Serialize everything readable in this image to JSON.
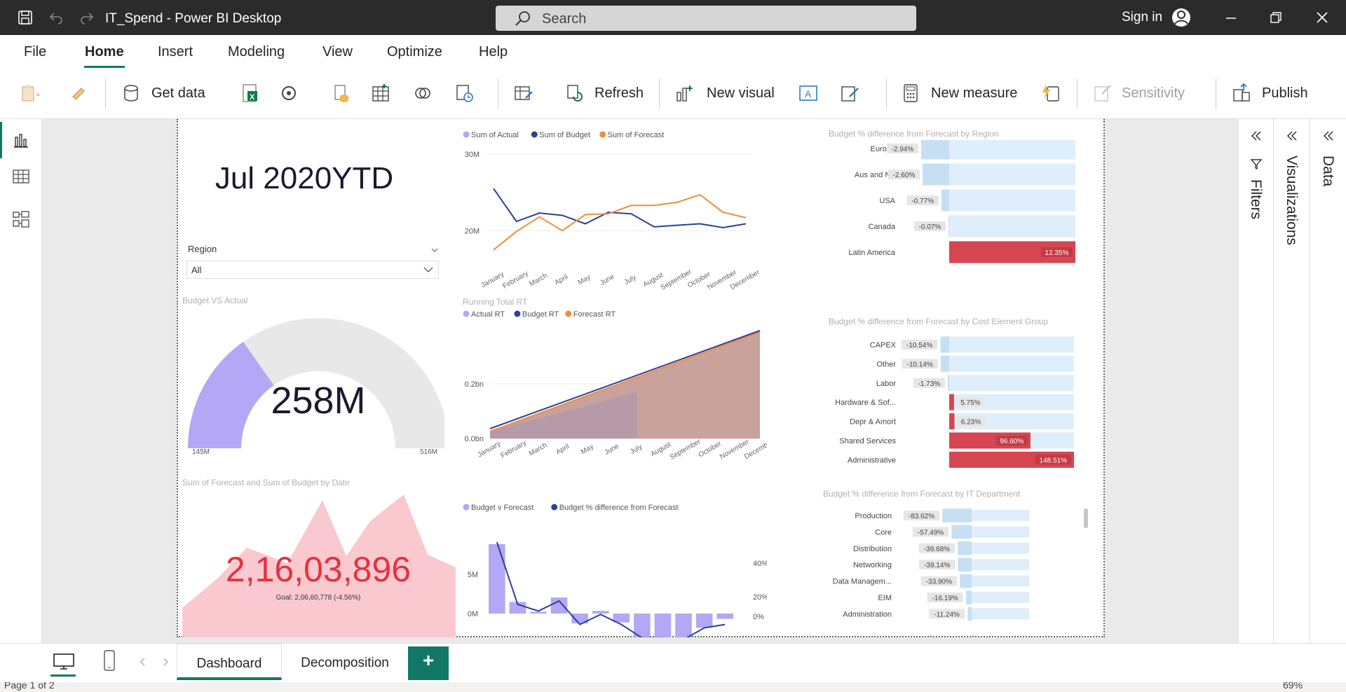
{
  "app": {
    "title": "IT_Spend - Power BI Desktop",
    "search_placeholder": "Search",
    "sign_in": "Sign in"
  },
  "menu": [
    "File",
    "Home",
    "Insert",
    "Modeling",
    "View",
    "Optimize",
    "Help"
  ],
  "ribbon": {
    "get_data": "Get data",
    "refresh": "Refresh",
    "new_visual": "New visual",
    "new_measure": "New measure",
    "sensitivity": "Sensitivity",
    "publish": "Publish"
  },
  "panes": {
    "filters": "Filters",
    "visualizations": "Visualizations",
    "data": "Data"
  },
  "pages": {
    "dashboard": "Dashboard",
    "decomposition": "Decomposition",
    "add": "+"
  },
  "status": {
    "page": "Page 1 of 2",
    "zoom": "69%"
  },
  "report": {
    "ytd_title": "Jul 2020YTD",
    "slicer": {
      "label": "Region",
      "value": "All"
    },
    "gauge": {
      "title": "Budget VS Actual",
      "value_label": "258M",
      "min_label": "145M",
      "max_label": "516M",
      "value": 258,
      "min": 145,
      "max": 516
    },
    "kpi": {
      "title": "Sum of Forecast and Sum of Budget by Date",
      "value": "2,16,03,896",
      "goal": "Goal: 2,06,60,778 (-4.56%)"
    },
    "region_title": "Budget % difference from Forecast by Region",
    "cost_title": "Budget % difference from Forecast by Cost Element Group",
    "it_title": "Budget % difference from Forecast by IT Department",
    "rt_title": "Running Total RT"
  },
  "chart_data": [
    {
      "type": "line",
      "categories": [
        "January",
        "February",
        "March",
        "April",
        "May",
        "June",
        "July",
        "August",
        "September",
        "October",
        "November",
        "December"
      ],
      "series": [
        {
          "name": "Sum of Actual",
          "color": "#b4a7f5",
          "values": []
        },
        {
          "name": "Sum of Budget",
          "color": "#2e3f99",
          "values": [
            25.5,
            21.2,
            22.3,
            22.0,
            20.9,
            22.4,
            22.2,
            20.5,
            20.7,
            20.9,
            20.4,
            20.9
          ]
        },
        {
          "name": "Sum of Forecast",
          "color": "#f28c3c",
          "values": [
            17.5,
            19.9,
            21.8,
            20.0,
            22.1,
            22.2,
            23.3,
            23.3,
            23.7,
            24.7,
            22.4,
            21.7
          ]
        }
      ],
      "yticks": [
        "30M",
        "20M"
      ],
      "ylim": [
        15,
        30
      ]
    },
    {
      "type": "area",
      "categories": [
        "January",
        "February",
        "March",
        "April",
        "May",
        "June",
        "July",
        "August",
        "September",
        "October",
        "November",
        "December"
      ],
      "series": [
        {
          "name": "Actual RT",
          "color": "#b4a7f5"
        },
        {
          "name": "Budget RT",
          "color": "#2e3f99"
        },
        {
          "name": "Forecast RT",
          "color": "#f28c3c"
        }
      ],
      "yticks": [
        "0.2bn",
        "0.0bn"
      ]
    },
    {
      "type": "bar",
      "categories": [
        "Europe",
        "Aus and NZ",
        "USA",
        "Canada",
        "Latin America"
      ],
      "values": [
        -2.94,
        -2.6,
        -0.77,
        -0.07,
        12.35
      ],
      "labels": [
        "-2.94%",
        "-2.60%",
        "-0.77%",
        "-0.07%",
        "12.35%"
      ]
    },
    {
      "type": "bar",
      "categories": [
        "CAPEX",
        "Other",
        "Labor",
        "Hardware & Sof...",
        "Depr & Amort",
        "Shared Services",
        "Administrative"
      ],
      "values": [
        -10.54,
        -10.14,
        -1.73,
        5.75,
        6.23,
        96.6,
        148.51
      ],
      "labels": [
        "-10.54%",
        "-10.14%",
        "-1.73%",
        "5.75%",
        "6.23%",
        "96.60%",
        "148.51%"
      ]
    },
    {
      "type": "bar",
      "categories": [
        "Production",
        "Core",
        "Distribution",
        "Networking",
        "Data Managem...",
        "EIM",
        "Administration"
      ],
      "values": [
        -83.62,
        -57.49,
        -39.68,
        -39.14,
        -33.9,
        -16.19,
        -11.24
      ],
      "labels": [
        "-83.62%",
        "-57.49%",
        "-39.68%",
        "-39.14%",
        "-33.90%",
        "-16.19%",
        "-11.24%"
      ]
    },
    {
      "type": "bar",
      "series": [
        {
          "name": "Budget v Forecast",
          "color": "#b4a7f5",
          "values": [
            7.8,
            1.3,
            0.2,
            1.8,
            -1.1,
            0.3,
            -1.0,
            -2.7,
            -2.7,
            -2.8,
            -1.6,
            -0.6
          ]
        },
        {
          "name": "Budget % difference from Forecast",
          "color": "#2e3f99",
          "values": [
            45,
            8,
            4,
            10,
            -4,
            2,
            -4,
            -12,
            -12,
            -13,
            -6,
            -4
          ]
        }
      ],
      "yticks_left": [
        "5M",
        "0M"
      ],
      "yticks_right": [
        "40%",
        "20%",
        "0%"
      ]
    }
  ]
}
